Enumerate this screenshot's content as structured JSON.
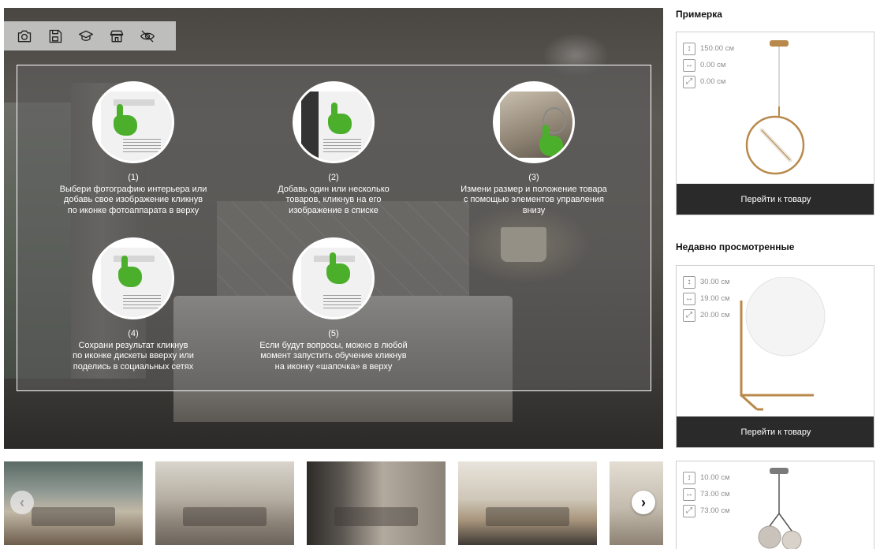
{
  "toolbar": {
    "icons": [
      "camera-icon",
      "save-icon",
      "tutorial-cap-icon",
      "store-icon",
      "hide-icon"
    ]
  },
  "tutorial": {
    "steps": [
      {
        "num": "(1)",
        "text": "Выбери фотографию интерьера или\nдобавь свое изображение кликнув\nпо иконке фотоаппарата в верху"
      },
      {
        "num": "(2)",
        "text": "Добавь один или несколько\nтоваров, кликнув на его\nизображение в списке"
      },
      {
        "num": "(3)",
        "text": "Измени размер и положение товара\nс помощью элементов управления\nвнизу"
      },
      {
        "num": "(4)",
        "text": "Сохрани результат кликнув\nпо иконке дискеты вверху или\nподелись в социальных сетях"
      },
      {
        "num": "(5)",
        "text": "Если будут вопросы, можно в любой\nмомент запустить обучение кликнув\nна иконку «шапочка» в верху"
      }
    ]
  },
  "carousel": {
    "prev_label": "‹",
    "next_label": "›"
  },
  "sidebar": {
    "fitting_title": "Примерка",
    "recent_title": "Недавно просмотренные",
    "products": [
      {
        "height": "150.00 см",
        "width": "0.00 см",
        "depth": "0.00 см",
        "button": "Перейти к товару"
      },
      {
        "height": "30.00 см",
        "width": "19.00 см",
        "depth": "20.00 см",
        "button": "Перейти к товару"
      },
      {
        "height": "10.00 см",
        "width": "73.00 см",
        "depth": "73.00 см"
      }
    ]
  },
  "colors": {
    "accent_green": "#4caf2b",
    "button_dark": "#2a2a2a",
    "brass": "#b8894a"
  }
}
